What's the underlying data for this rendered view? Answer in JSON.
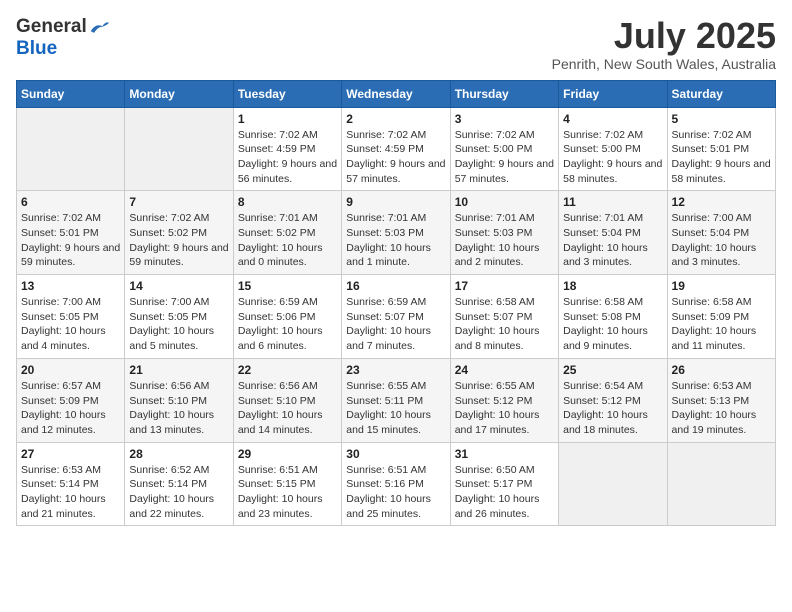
{
  "header": {
    "logo_general": "General",
    "logo_blue": "Blue",
    "month_year": "July 2025",
    "location": "Penrith, New South Wales, Australia"
  },
  "weekdays": [
    "Sunday",
    "Monday",
    "Tuesday",
    "Wednesday",
    "Thursday",
    "Friday",
    "Saturday"
  ],
  "weeks": [
    [
      {
        "day": "",
        "info": ""
      },
      {
        "day": "",
        "info": ""
      },
      {
        "day": "1",
        "info": "Sunrise: 7:02 AM\nSunset: 4:59 PM\nDaylight: 9 hours and 56 minutes."
      },
      {
        "day": "2",
        "info": "Sunrise: 7:02 AM\nSunset: 4:59 PM\nDaylight: 9 hours and 57 minutes."
      },
      {
        "day": "3",
        "info": "Sunrise: 7:02 AM\nSunset: 5:00 PM\nDaylight: 9 hours and 57 minutes."
      },
      {
        "day": "4",
        "info": "Sunrise: 7:02 AM\nSunset: 5:00 PM\nDaylight: 9 hours and 58 minutes."
      },
      {
        "day": "5",
        "info": "Sunrise: 7:02 AM\nSunset: 5:01 PM\nDaylight: 9 hours and 58 minutes."
      }
    ],
    [
      {
        "day": "6",
        "info": "Sunrise: 7:02 AM\nSunset: 5:01 PM\nDaylight: 9 hours and 59 minutes."
      },
      {
        "day": "7",
        "info": "Sunrise: 7:02 AM\nSunset: 5:02 PM\nDaylight: 9 hours and 59 minutes."
      },
      {
        "day": "8",
        "info": "Sunrise: 7:01 AM\nSunset: 5:02 PM\nDaylight: 10 hours and 0 minutes."
      },
      {
        "day": "9",
        "info": "Sunrise: 7:01 AM\nSunset: 5:03 PM\nDaylight: 10 hours and 1 minute."
      },
      {
        "day": "10",
        "info": "Sunrise: 7:01 AM\nSunset: 5:03 PM\nDaylight: 10 hours and 2 minutes."
      },
      {
        "day": "11",
        "info": "Sunrise: 7:01 AM\nSunset: 5:04 PM\nDaylight: 10 hours and 3 minutes."
      },
      {
        "day": "12",
        "info": "Sunrise: 7:00 AM\nSunset: 5:04 PM\nDaylight: 10 hours and 3 minutes."
      }
    ],
    [
      {
        "day": "13",
        "info": "Sunrise: 7:00 AM\nSunset: 5:05 PM\nDaylight: 10 hours and 4 minutes."
      },
      {
        "day": "14",
        "info": "Sunrise: 7:00 AM\nSunset: 5:05 PM\nDaylight: 10 hours and 5 minutes."
      },
      {
        "day": "15",
        "info": "Sunrise: 6:59 AM\nSunset: 5:06 PM\nDaylight: 10 hours and 6 minutes."
      },
      {
        "day": "16",
        "info": "Sunrise: 6:59 AM\nSunset: 5:07 PM\nDaylight: 10 hours and 7 minutes."
      },
      {
        "day": "17",
        "info": "Sunrise: 6:58 AM\nSunset: 5:07 PM\nDaylight: 10 hours and 8 minutes."
      },
      {
        "day": "18",
        "info": "Sunrise: 6:58 AM\nSunset: 5:08 PM\nDaylight: 10 hours and 9 minutes."
      },
      {
        "day": "19",
        "info": "Sunrise: 6:58 AM\nSunset: 5:09 PM\nDaylight: 10 hours and 11 minutes."
      }
    ],
    [
      {
        "day": "20",
        "info": "Sunrise: 6:57 AM\nSunset: 5:09 PM\nDaylight: 10 hours and 12 minutes."
      },
      {
        "day": "21",
        "info": "Sunrise: 6:56 AM\nSunset: 5:10 PM\nDaylight: 10 hours and 13 minutes."
      },
      {
        "day": "22",
        "info": "Sunrise: 6:56 AM\nSunset: 5:10 PM\nDaylight: 10 hours and 14 minutes."
      },
      {
        "day": "23",
        "info": "Sunrise: 6:55 AM\nSunset: 5:11 PM\nDaylight: 10 hours and 15 minutes."
      },
      {
        "day": "24",
        "info": "Sunrise: 6:55 AM\nSunset: 5:12 PM\nDaylight: 10 hours and 17 minutes."
      },
      {
        "day": "25",
        "info": "Sunrise: 6:54 AM\nSunset: 5:12 PM\nDaylight: 10 hours and 18 minutes."
      },
      {
        "day": "26",
        "info": "Sunrise: 6:53 AM\nSunset: 5:13 PM\nDaylight: 10 hours and 19 minutes."
      }
    ],
    [
      {
        "day": "27",
        "info": "Sunrise: 6:53 AM\nSunset: 5:14 PM\nDaylight: 10 hours and 21 minutes."
      },
      {
        "day": "28",
        "info": "Sunrise: 6:52 AM\nSunset: 5:14 PM\nDaylight: 10 hours and 22 minutes."
      },
      {
        "day": "29",
        "info": "Sunrise: 6:51 AM\nSunset: 5:15 PM\nDaylight: 10 hours and 23 minutes."
      },
      {
        "day": "30",
        "info": "Sunrise: 6:51 AM\nSunset: 5:16 PM\nDaylight: 10 hours and 25 minutes."
      },
      {
        "day": "31",
        "info": "Sunrise: 6:50 AM\nSunset: 5:17 PM\nDaylight: 10 hours and 26 minutes."
      },
      {
        "day": "",
        "info": ""
      },
      {
        "day": "",
        "info": ""
      }
    ]
  ]
}
